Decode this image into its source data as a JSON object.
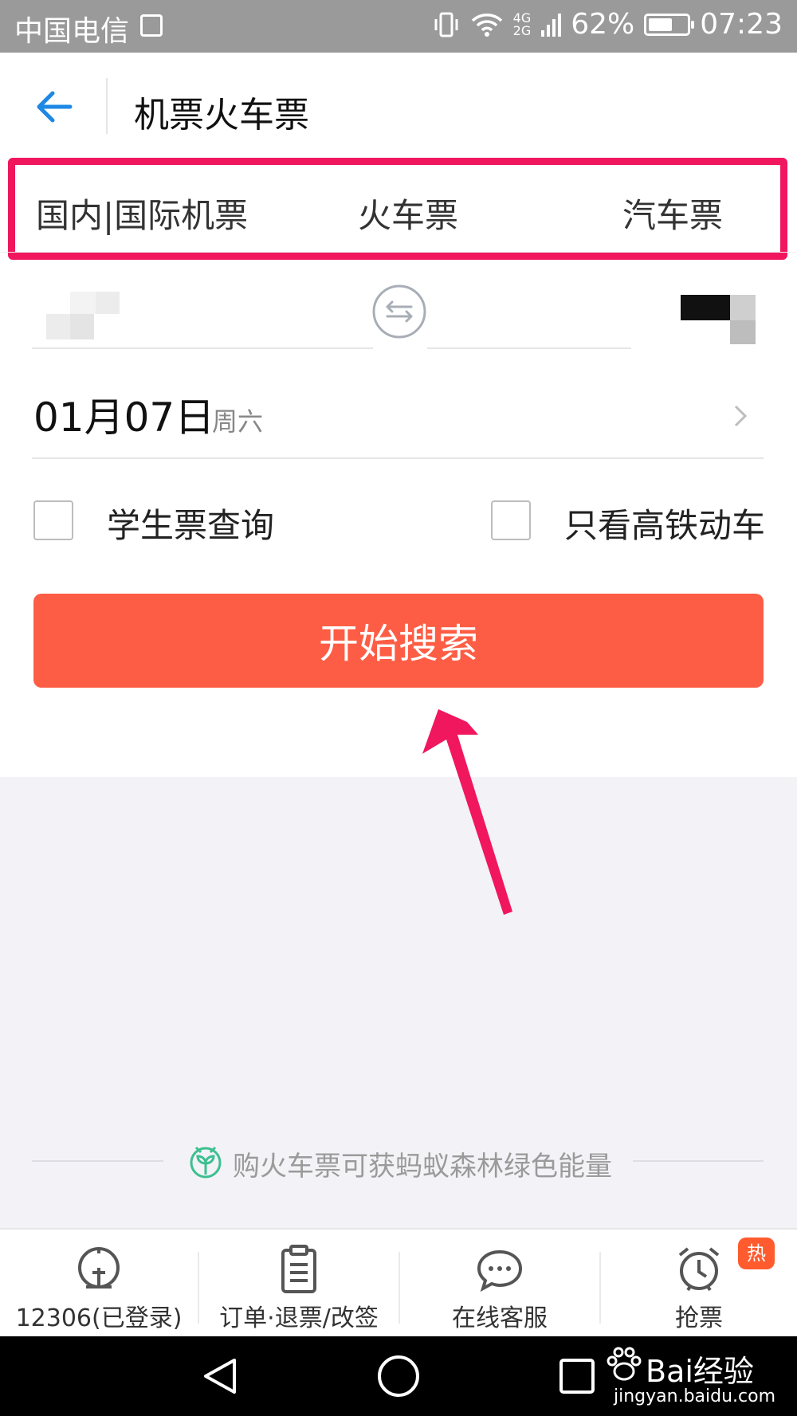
{
  "status_bar": {
    "carrier": "中国电信",
    "network": "4G",
    "network2": "2G",
    "battery": "62%",
    "battery_level": 0.62,
    "time": "07:23"
  },
  "header": {
    "title": "机票火车票"
  },
  "tabs": [
    {
      "label": "国内|国际机票"
    },
    {
      "label": "火车票"
    },
    {
      "label": "汽车票"
    }
  ],
  "date": {
    "main": "01月07日",
    "weekday": "周六"
  },
  "options": {
    "student": "学生票查询",
    "high_speed": "只看高铁动车"
  },
  "search": {
    "label": "开始搜索"
  },
  "promo": {
    "text": "购火车票可获蚂蚁森林绿色能量"
  },
  "bottom_nav": [
    {
      "label": "12306(已登录)",
      "icon": "train-icon"
    },
    {
      "label": "订单·退票/改签",
      "icon": "clipboard-icon"
    },
    {
      "label": "在线客服",
      "icon": "chat-icon"
    },
    {
      "label": "抢票",
      "icon": "alarm-clock-icon"
    }
  ],
  "hot_badge": "热",
  "watermark": {
    "brand": "Bai经验",
    "url": "jingyan.baidu.com"
  },
  "colors": {
    "accent_blue": "#1e88e5",
    "search_button": "#fe5d45",
    "highlight": "#f0175f",
    "eco_green": "#3cbf8f"
  }
}
